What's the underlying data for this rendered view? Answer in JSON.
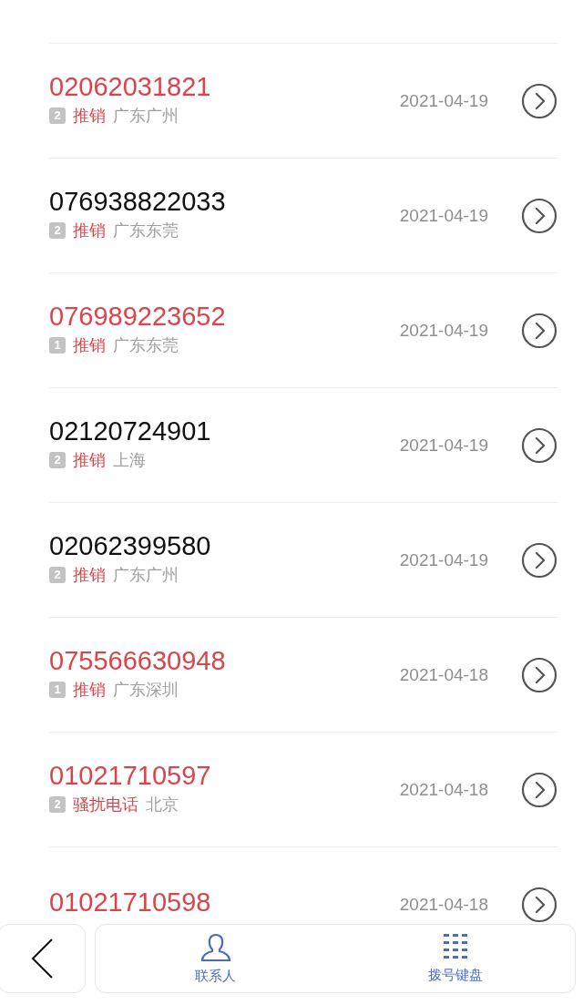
{
  "calls": [
    {
      "number": "02062031821",
      "missed": true,
      "count": "2",
      "tag": "推销",
      "location": "广东广州",
      "date": "2021-04-19"
    },
    {
      "number": "076938822033",
      "missed": false,
      "count": "2",
      "tag": "推销",
      "location": "广东东莞",
      "date": "2021-04-19"
    },
    {
      "number": "076989223652",
      "missed": true,
      "count": "1",
      "tag": "推销",
      "location": "广东东莞",
      "date": "2021-04-19"
    },
    {
      "number": "02120724901",
      "missed": false,
      "count": "2",
      "tag": "推销",
      "location": "上海",
      "date": "2021-04-19"
    },
    {
      "number": "02062399580",
      "missed": false,
      "count": "2",
      "tag": "推销",
      "location": "广东广州",
      "date": "2021-04-19"
    },
    {
      "number": "075566630948",
      "missed": true,
      "count": "1",
      "tag": "推销",
      "location": "广东深圳",
      "date": "2021-04-18"
    },
    {
      "number": "01021710597",
      "missed": true,
      "count": "2",
      "tag": "骚扰电话",
      "location": "北京",
      "date": "2021-04-18"
    },
    {
      "number": "01021710598",
      "missed": true,
      "date": "2021-04-18"
    }
  ],
  "bottom_bar": {
    "tabs": [
      {
        "label": "联系人",
        "kind": "contacts"
      },
      {
        "label": "拨号键盘",
        "kind": "keypad"
      }
    ]
  }
}
